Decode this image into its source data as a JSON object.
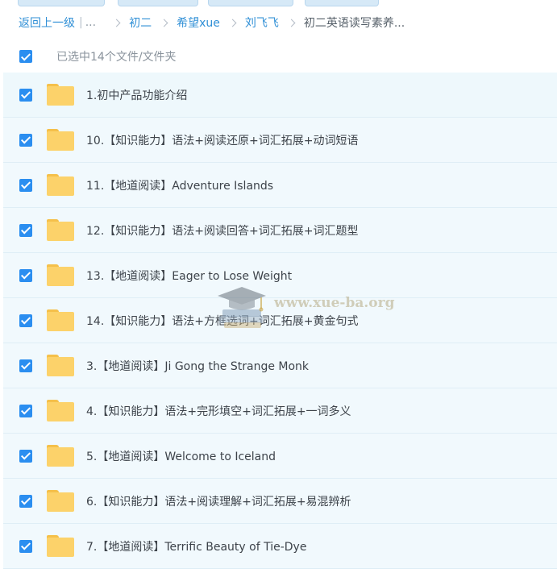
{
  "breadcrumb": {
    "back_label": "返回上一级",
    "separator": "|",
    "ellipsis": "...",
    "items": [
      "初二",
      "希望xue",
      "刘飞飞"
    ],
    "current": "初二英语读写素养..."
  },
  "selection": {
    "label": "已选中14个文件/文件夹",
    "checked": true
  },
  "files": [
    {
      "name": "1.初中产品功能介绍",
      "type": "folder",
      "checked": true
    },
    {
      "name": "10.【知识能力】语法+阅读还原+词汇拓展+动词短语",
      "type": "folder",
      "checked": true
    },
    {
      "name": "11.【地道阅读】Adventure Islands",
      "type": "folder",
      "checked": true
    },
    {
      "name": "12.【知识能力】语法+阅读回答+词汇拓展+词汇题型",
      "type": "folder",
      "checked": true
    },
    {
      "name": "13.【地道阅读】Eager to Lose Weight",
      "type": "folder",
      "checked": true
    },
    {
      "name": "14.【知识能力】语法+方框选词+词汇拓展+黄金句式",
      "type": "folder",
      "checked": true
    },
    {
      "name": "3.【地道阅读】Ji Gong the Strange Monk",
      "type": "folder",
      "checked": true
    },
    {
      "name": "4.【知识能力】语法+完形填空+词汇拓展+一词多义",
      "type": "folder",
      "checked": true
    },
    {
      "name": "5.【地道阅读】Welcome to Iceland",
      "type": "folder",
      "checked": true
    },
    {
      "name": "6.【知识能力】语法+阅读理解+词汇拓展+易混辨析",
      "type": "folder",
      "checked": true
    },
    {
      "name": "7.【地道阅读】Terrific Beauty of Tie-Dye",
      "type": "folder",
      "checked": true
    }
  ],
  "watermark": {
    "text": "www.xue-ba.org",
    "icon": "graduation-cap-books-icon"
  },
  "colors": {
    "link": "#2f8fd6",
    "checkbox": "#2b8ef0",
    "row_bg": "#f1f9fd",
    "folder": "#fcd26a"
  }
}
